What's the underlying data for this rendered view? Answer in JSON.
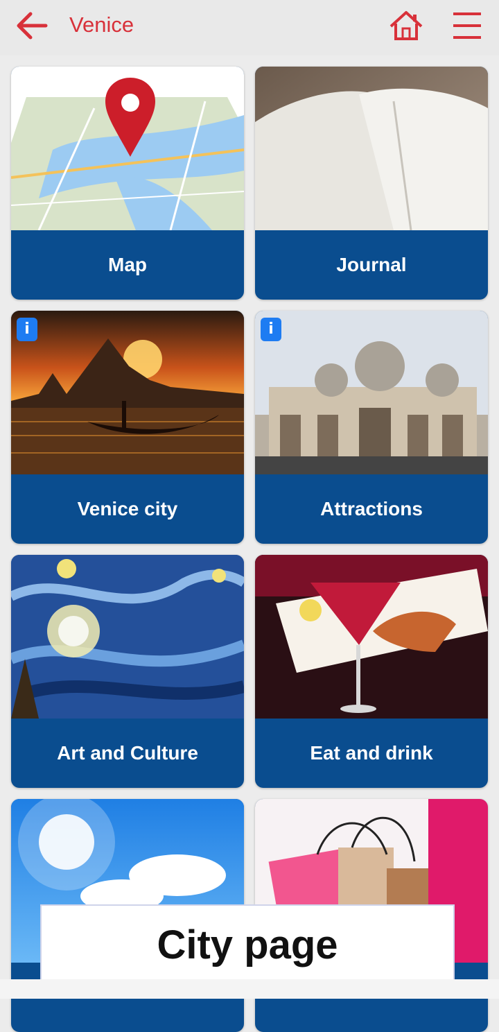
{
  "header": {
    "title": "Venice",
    "back_icon": "arrow-left-icon",
    "home_icon": "home-icon",
    "menu_icon": "hamburger-menu-icon",
    "accent_color": "#d8313a"
  },
  "tiles": [
    {
      "label": "Map",
      "image": "map-image",
      "info": false
    },
    {
      "label": "Journal",
      "image": "journal-image",
      "info": false
    },
    {
      "label": "Venice city",
      "image": "venice-city-image",
      "info": true
    },
    {
      "label": "Attractions",
      "image": "attractions-image",
      "info": true
    },
    {
      "label": "Art and Culture",
      "image": "art-culture-image",
      "info": false
    },
    {
      "label": "Eat and drink",
      "image": "eat-drink-image",
      "info": false
    },
    {
      "label": "",
      "image": "sky-image",
      "info": false
    },
    {
      "label": "",
      "image": "shopping-image",
      "info": false
    }
  ],
  "info_badge_text": "i",
  "caption": "City page",
  "colors": {
    "tile_label_bg": "#0a4d8f",
    "info_badge": "#1e7cf2"
  }
}
